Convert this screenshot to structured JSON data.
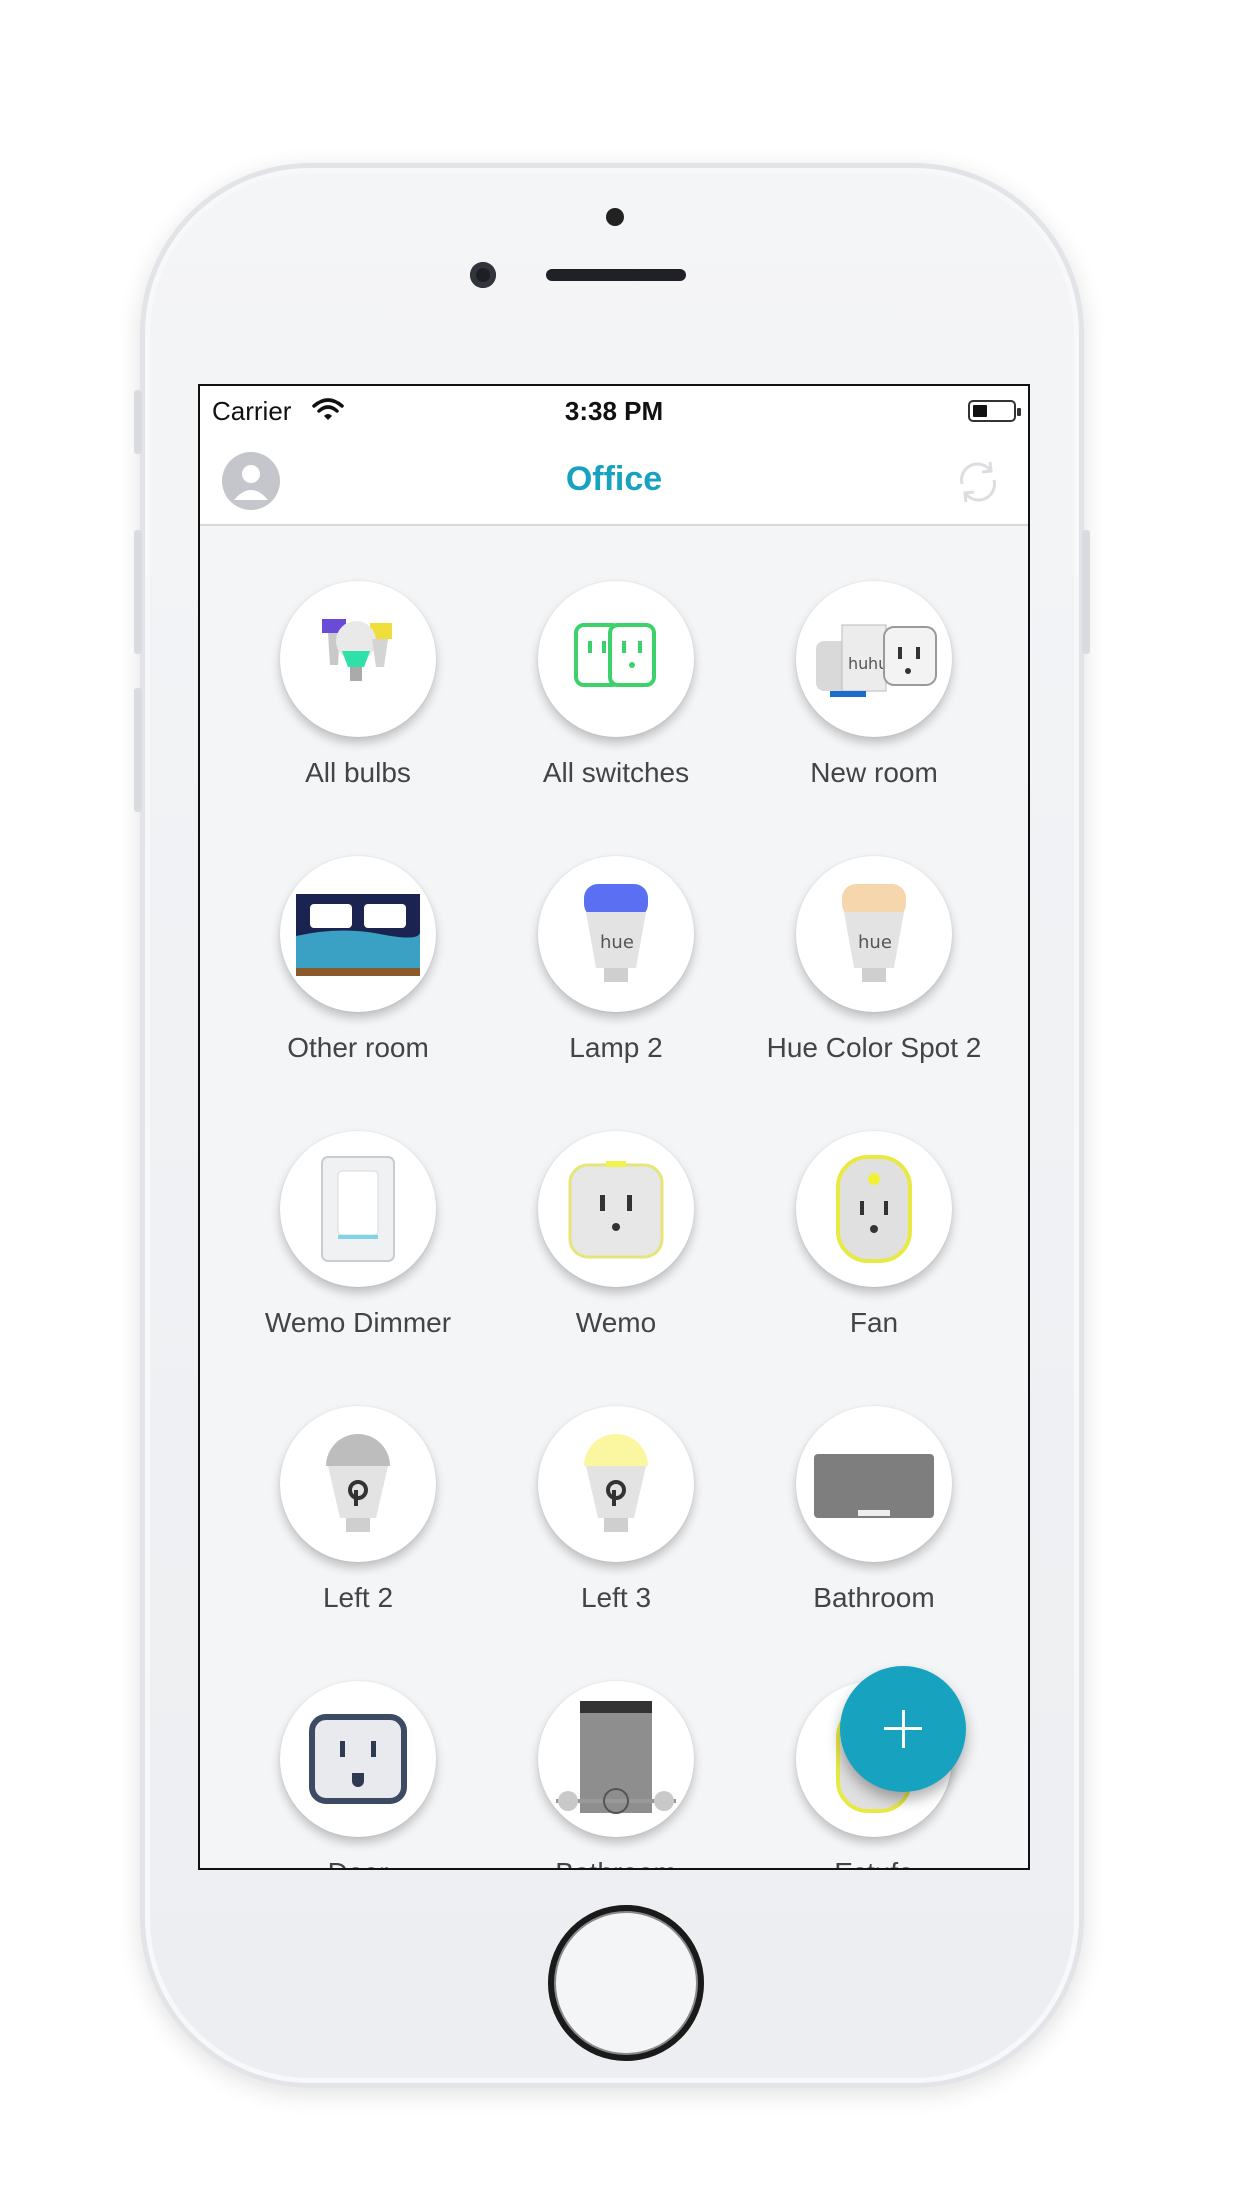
{
  "status_bar": {
    "carrier": "Carrier",
    "time": "3:38 PM"
  },
  "header": {
    "title": "Office"
  },
  "devices": [
    {
      "label": "All bulbs",
      "icon": "multi-bulb-icon"
    },
    {
      "label": "All switches",
      "icon": "smart-plugs-icon"
    },
    {
      "label": "New room",
      "icon": "devices-collage-icon"
    },
    {
      "label": "Other room",
      "icon": "bed-icon"
    },
    {
      "label": "Lamp 2",
      "icon": "hue-bulb-blue-icon"
    },
    {
      "label": "Hue Color Spot 2",
      "icon": "hue-bulb-warm-icon"
    },
    {
      "label": "Wemo Dimmer",
      "icon": "wall-dimmer-icon"
    },
    {
      "label": "Wemo",
      "icon": "wemo-plug-icon"
    },
    {
      "label": "Fan",
      "icon": "plug-yellow-icon"
    },
    {
      "label": "Left 2",
      "icon": "tplink-bulb-gray-icon"
    },
    {
      "label": "Left 3",
      "icon": "tplink-bulb-yellow-icon"
    },
    {
      "label": "Bathroom",
      "icon": "sonos-speaker-icon"
    },
    {
      "label": "Door",
      "icon": "outlet-icon"
    },
    {
      "label": "Bathroom",
      "icon": "sonos-tall-speaker-icon"
    },
    {
      "label": "Estufa",
      "icon": "plug-yellow-icon"
    }
  ],
  "fab": {
    "icon": "plus-icon"
  },
  "colors": {
    "accent": "#17a2bf"
  }
}
